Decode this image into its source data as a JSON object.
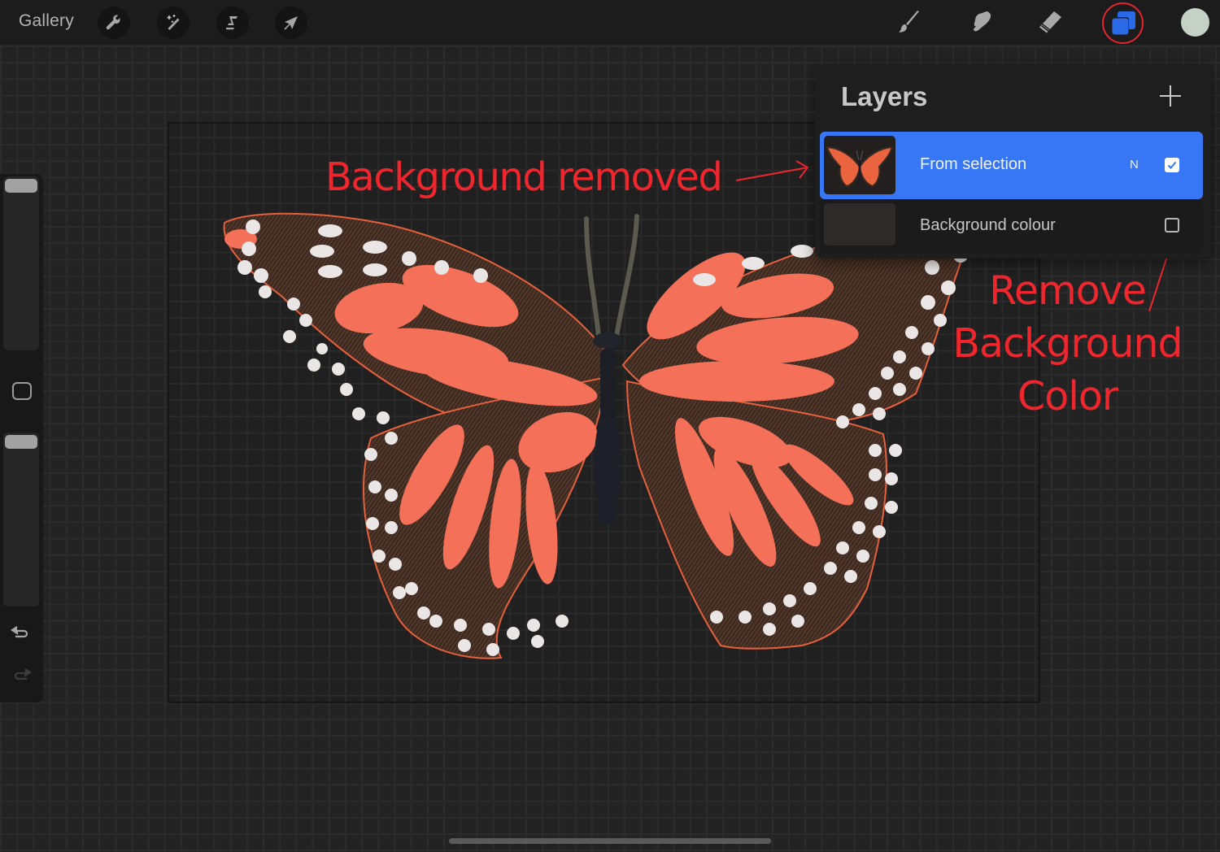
{
  "toolbar": {
    "gallery_label": "Gallery",
    "left_tools": [
      {
        "name": "actions",
        "icon": "wrench-icon"
      },
      {
        "name": "adjustments",
        "icon": "magic-wand-icon"
      },
      {
        "name": "selection",
        "icon": "selection-s-icon"
      },
      {
        "name": "transform",
        "icon": "arrow-cursor-icon"
      }
    ],
    "right_tools": [
      {
        "name": "paint",
        "icon": "brush-icon"
      },
      {
        "name": "smudge",
        "icon": "smudge-finger-icon"
      },
      {
        "name": "erase",
        "icon": "eraser-icon"
      },
      {
        "name": "layers",
        "icon": "layers-icon",
        "active": true
      },
      {
        "name": "colors",
        "icon": "color-swatch"
      }
    ],
    "current_color": "#c5d1c7",
    "layers_accent": "#2a6ae6",
    "highlight_ring_color": "#e3262c"
  },
  "sidebar": {
    "brush_size_level": 1.0,
    "opacity_level": 1.0,
    "modify_button": "square-icon",
    "undo": "undo-icon",
    "redo": "redo-icon"
  },
  "layers_panel": {
    "title": "Layers",
    "add_button": "plus-icon",
    "layers": [
      {
        "name": "From selection",
        "blend_mode": "N",
        "visible": true,
        "selected": true,
        "thumbnail": "butterfly"
      },
      {
        "name": "Background colour",
        "visible": false,
        "selected": false,
        "thumbnail": "dark-swatch"
      }
    ],
    "selected_color": "#3777f5"
  },
  "annotations": {
    "left_label": "Background removed",
    "right_label_lines": [
      "Remove",
      "Background",
      "Color"
    ],
    "color": "#f0262e"
  },
  "canvas": {
    "content": "monarch butterfly"
  }
}
